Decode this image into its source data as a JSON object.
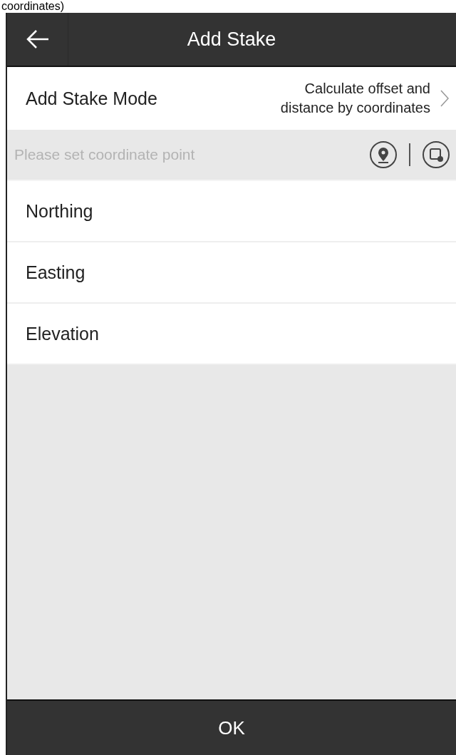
{
  "caption": "coordinates)",
  "header": {
    "title": "Add Stake"
  },
  "mode_row": {
    "label": "Add Stake Mode",
    "value_lines": [
      "Calculate offset and",
      "distance by coordinates"
    ]
  },
  "coordinate_bar": {
    "placeholder": "Please set coordinate point"
  },
  "fields": [
    {
      "label": "Northing"
    },
    {
      "label": "Easting"
    },
    {
      "label": "Elevation"
    }
  ],
  "footer": {
    "button": "OK"
  }
}
